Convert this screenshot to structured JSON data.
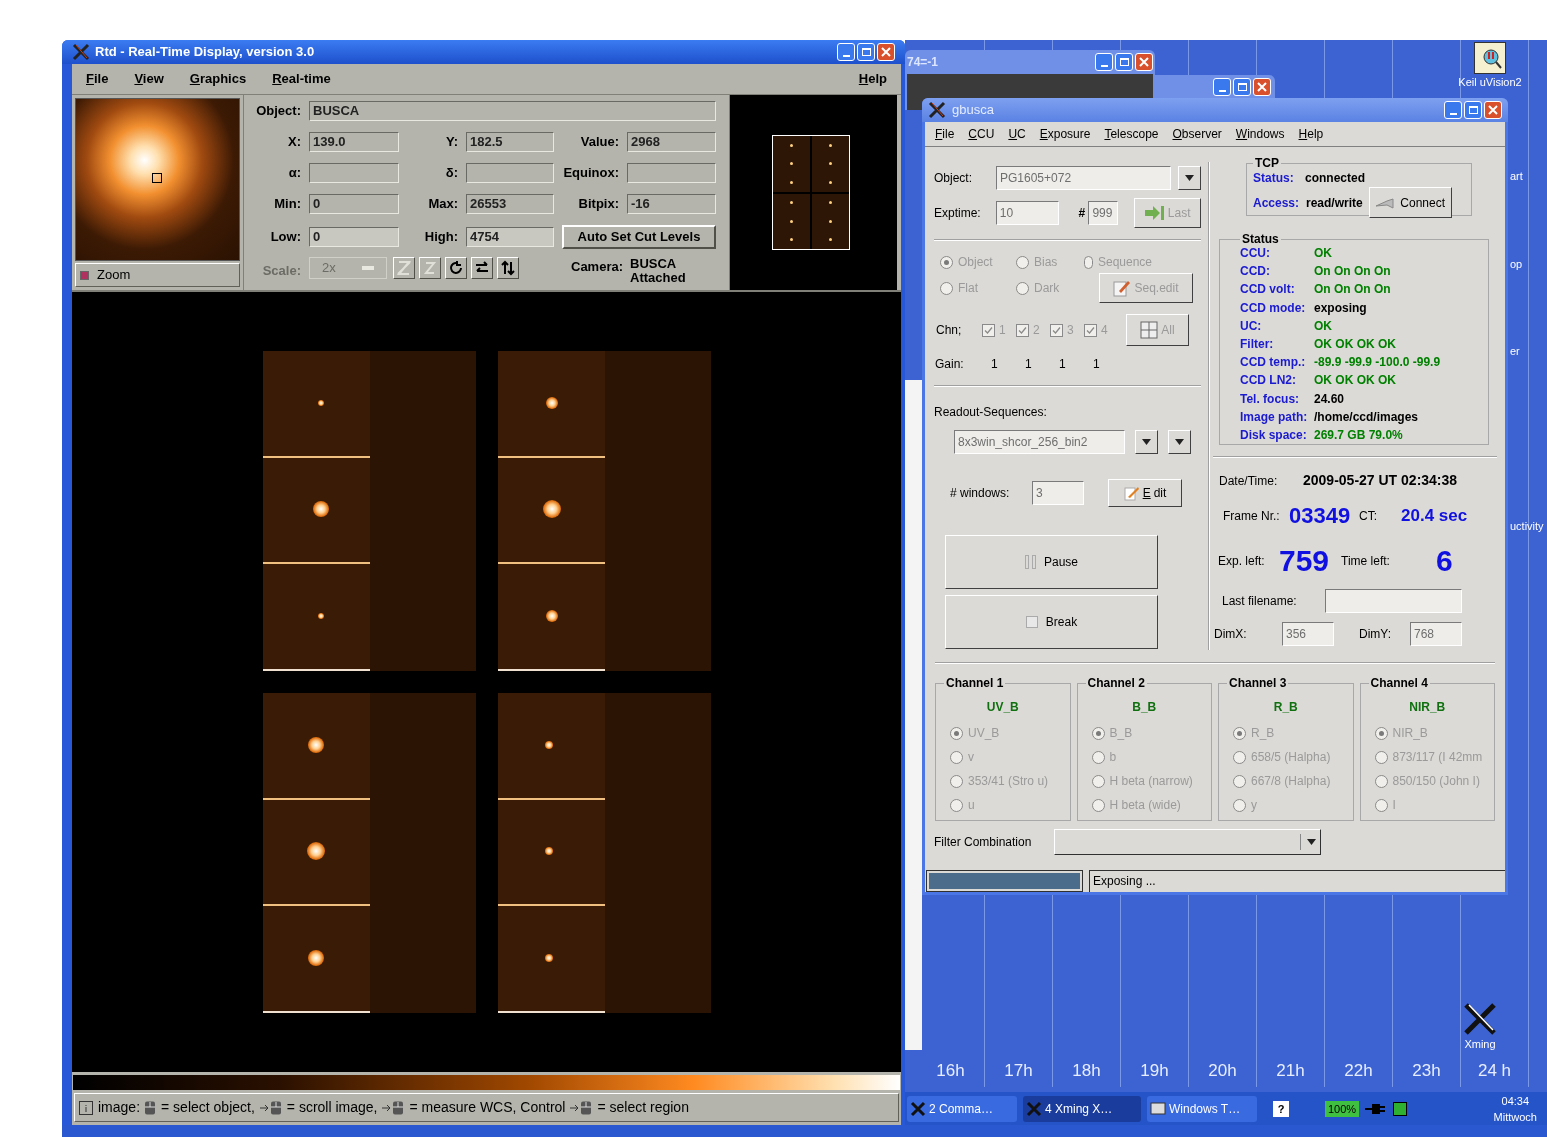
{
  "desktop": {
    "background_window": {
      "title": "74=-1"
    },
    "icons": [
      {
        "label": "Keil uVision2"
      },
      {
        "label": "Xming"
      }
    ],
    "edge_texts": [
      "art",
      "op",
      "er",
      "uctivity"
    ],
    "timeline": [
      "16h",
      "17h",
      "18h",
      "19h",
      "20h",
      "21h",
      "22h",
      "23h",
      "24 h"
    ]
  },
  "taskbar": {
    "items": [
      {
        "label": "2 Comma…",
        "selected": false
      },
      {
        "label": "4 Xming X…",
        "selected": true
      },
      {
        "label": "Windows T…",
        "selected": false
      }
    ],
    "help_icon": "?",
    "battery": "100%",
    "clock": "04:34",
    "day": "Mittwoch"
  },
  "rtd": {
    "title": "Rtd - Real-Time Display, version 3.0",
    "menu": [
      {
        "label": "File"
      },
      {
        "label": "View"
      },
      {
        "label": "Graphics"
      },
      {
        "label": "Real-time"
      }
    ],
    "help": "Help",
    "zoom": {
      "label": "Zoom",
      "checked": true
    },
    "object": {
      "label": "Object:",
      "value": "BUSCA"
    },
    "fields": [
      {
        "label": "X:",
        "value": "139.0"
      },
      {
        "label": "Y:",
        "value": "182.5"
      },
      {
        "label": "Value:",
        "value": "2968"
      },
      {
        "label": "α:"
      },
      {
        "label": "δ:"
      },
      {
        "label": "Equinox:"
      },
      {
        "label": "Min:",
        "value": "0"
      },
      {
        "label": "Max:",
        "value": "26553"
      },
      {
        "label": "Bitpix:",
        "value": "-16"
      },
      {
        "label": "Low:",
        "value": "0"
      },
      {
        "label": "High:",
        "value": "4754"
      }
    ],
    "cut_button": "Auto Set Cut Levels",
    "scale": {
      "label": "Scale:",
      "value": "2x"
    },
    "camera": {
      "label": "Camera:",
      "lines": [
        "BUSCA",
        "Attached"
      ]
    },
    "status_parts": [
      "image:",
      "= select object,",
      "= scroll image,",
      "= measure WCS, Control",
      "= select region"
    ]
  },
  "gbusca": {
    "title": "gbusca",
    "menu": [
      {
        "label": "File"
      },
      {
        "label": "CCU"
      },
      {
        "label": "UC"
      },
      {
        "label": "Exposure"
      },
      {
        "label": "Telescope"
      },
      {
        "label": "Observer"
      },
      {
        "label": "Windows"
      },
      {
        "label": "Help"
      }
    ],
    "object": {
      "label": "Object:",
      "value": "PG1605+072"
    },
    "exptime": {
      "label": "Exptime:",
      "value": "10",
      "hash": "#",
      "count": "999",
      "last_button": "Last"
    },
    "modes": [
      {
        "label": "Object",
        "selected": true
      },
      {
        "label": "Bias",
        "selected": false
      },
      {
        "label": "Sequence",
        "selected": false
      },
      {
        "label": "Flat",
        "selected": false
      },
      {
        "label": "Dark",
        "selected": false
      }
    ],
    "seq_edit_button": "Seq.edit",
    "chn": {
      "label": "Chn;",
      "channels": [
        {
          "label": "1",
          "checked": true
        },
        {
          "label": "2",
          "checked": true
        },
        {
          "label": "3",
          "checked": true
        },
        {
          "label": "4",
          "checked": true
        }
      ],
      "all_button": "All"
    },
    "gain": {
      "label": "Gain:",
      "values": [
        "1",
        "1",
        "1",
        "1"
      ]
    },
    "readout": {
      "label": "Readout-Sequences:",
      "value": "8x3win_shcor_256_bin2"
    },
    "windows": {
      "label": "# windows:",
      "value": "3",
      "edit_button": "Edit"
    },
    "pause_button": "Pause",
    "break_button": "Break",
    "tcp": {
      "title": "TCP",
      "status_label": "Status:",
      "status": "connected",
      "access_label": "Access:",
      "access": "read/write",
      "connect_button": "Connect"
    },
    "status": {
      "title": "Status",
      "rows": [
        {
          "label": "CCU:",
          "value": "OK",
          "color": "#008000"
        },
        {
          "label": "CCD:",
          "value": "On On On On",
          "color": "#008000"
        },
        {
          "label": "CCD volt:",
          "value": "On On On On",
          "color": "#008000"
        },
        {
          "label": "CCD mode:",
          "value": "exposing",
          "color": "#000000"
        },
        {
          "label": "UC:",
          "value": "OK",
          "color": "#008000"
        },
        {
          "label": "Filter:",
          "value": "OK OK OK OK",
          "color": "#008000"
        },
        {
          "label": "CCD temp.:",
          "value": "-89.9 -99.9 -100.0 -99.9",
          "color": "#008000"
        },
        {
          "label": "CCD LN2:",
          "value": "OK OK OK OK",
          "color": "#008000"
        },
        {
          "label": "Tel. focus:",
          "value": "24.60",
          "color": "#000000"
        },
        {
          "label": "Image path:",
          "value": "/home/ccd/images",
          "color": "#000000"
        },
        {
          "label": "Disk space:",
          "value": "269.7 GB 79.0%",
          "color": "#008000"
        }
      ]
    },
    "datetime": {
      "label": "Date/Time:",
      "value": "2009-05-27 UT 02:34:38"
    },
    "frame": {
      "label": "Frame Nr.:",
      "value": "03349",
      "ct_label": "CT:",
      "ct": "20.4 sec"
    },
    "exp_left": {
      "label": "Exp. left:",
      "value": "759",
      "time_label": "Time left:",
      "time": "6"
    },
    "last_filename": {
      "label": "Last filename:"
    },
    "dims": [
      {
        "label": "DimX:",
        "value": "356"
      },
      {
        "label": "DimY:",
        "value": "768"
      }
    ],
    "channels": [
      {
        "title": "Channel 1",
        "filter": "UV_B",
        "options": [
          {
            "label": "UV_B",
            "selected": true
          },
          {
            "label": "v",
            "selected": false
          },
          {
            "label": "353/41 (Stro u)",
            "selected": false
          },
          {
            "label": "u",
            "selected": false
          }
        ]
      },
      {
        "title": "Channel 2",
        "filter": "B_B",
        "options": [
          {
            "label": "B_B",
            "selected": true
          },
          {
            "label": "b",
            "selected": false
          },
          {
            "label": "H beta (narrow)",
            "selected": false
          },
          {
            "label": "H beta (wide)",
            "selected": false
          }
        ]
      },
      {
        "title": "Channel 3",
        "filter": "R_B",
        "options": [
          {
            "label": "R_B",
            "selected": true
          },
          {
            "label": "658/5 (Halpha)",
            "selected": false
          },
          {
            "label": "667/8 (Halpha)",
            "selected": false
          },
          {
            "label": "y",
            "selected": false
          }
        ]
      },
      {
        "title": "Channel 4",
        "filter": "NIR_B",
        "options": [
          {
            "label": "NIR_B",
            "selected": true
          },
          {
            "label": "873/117 (I 42mm",
            "selected": false
          },
          {
            "label": "850/150 (John I)",
            "selected": false
          },
          {
            "label": "I",
            "selected": false
          }
        ]
      }
    ],
    "filter_combination": {
      "label": "Filter Combination"
    },
    "progress": {
      "level": 1
    },
    "status_text": "Exposing ..."
  }
}
